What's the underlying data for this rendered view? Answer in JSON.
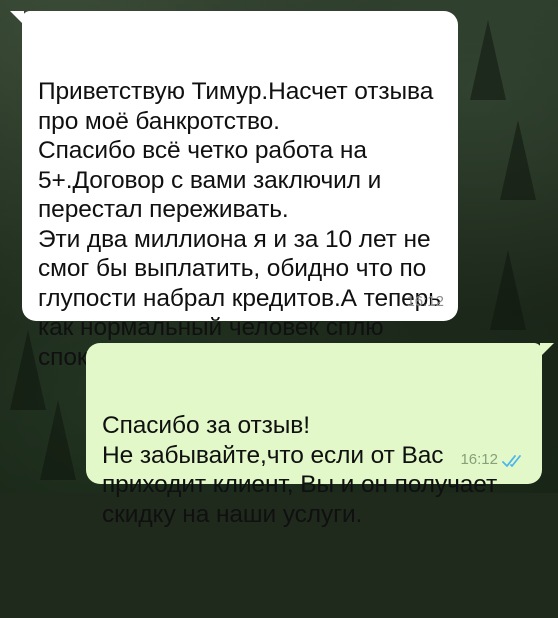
{
  "messages": [
    {
      "direction": "incoming",
      "text": "Приветствую Тимур.Насчет отзыва\nпро моё банкротство.\nСпасибо всё четко работа на\n5+.Договор с вами заключил и\nперестал переживать.\nЭти два миллиона я и за 10 лет не\nсмог бы выплатить, обидно что по\nглупости набрал кредитов.А теперь\nкак нормальный человек сплю\nспокойно!",
      "time": "16:12"
    },
    {
      "direction": "outgoing",
      "text": "Спасибо за отзыв!\nНе забывайте,что если от Вас\nприходит клиент, Вы и он  получает\nскидку на наши услуги.",
      "time": "16:12",
      "status": "read-double-check-icon"
    }
  ],
  "colors": {
    "incoming_bubble": "#ffffff",
    "outgoing_bubble": "#e2f8c9",
    "read_ticks": "#4fb6ec",
    "background": "#1f2a1d"
  }
}
